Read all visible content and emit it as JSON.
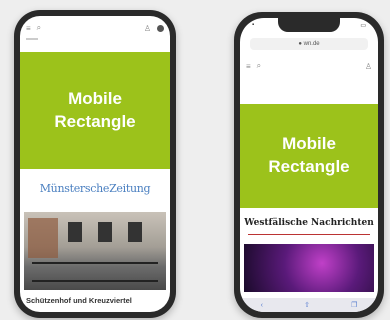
{
  "ad_label_line1": "Mobile",
  "ad_label_line2": "Rectangle",
  "colors": {
    "ad_green": "#9cc21b",
    "background": "#eeeeee",
    "phone_frame": "#2a2a2a"
  },
  "android": {
    "newspaper_logo": "MünsterscheZeitung",
    "headline": "Schützenhof und Kreuzviertel"
  },
  "iphone": {
    "url": "● wn.de",
    "newspaper_logo": "Westfälische Nachrichten"
  }
}
